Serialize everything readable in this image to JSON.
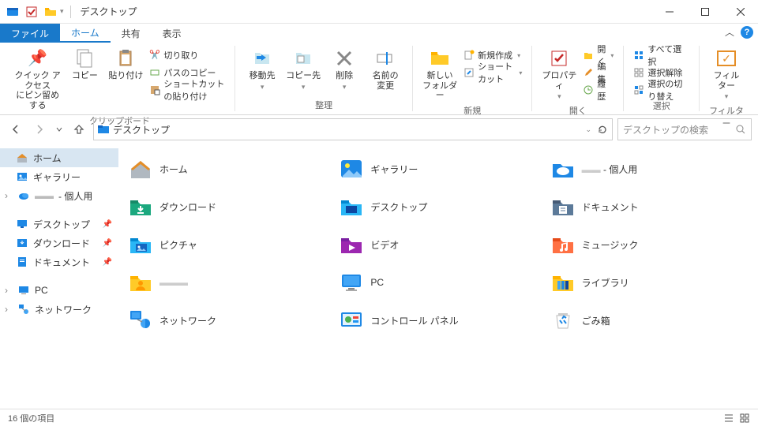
{
  "titlebar": {
    "title": "デスクトップ"
  },
  "tabs": {
    "file": "ファイル",
    "home": "ホーム",
    "share": "共有",
    "view": "表示"
  },
  "ribbon": {
    "pin": "クイック アクセス\nにピン留めする",
    "copy": "コピー",
    "paste": "貼り付け",
    "cut": "切り取り",
    "copypath": "パスのコピー",
    "pasteshortcut": "ショートカットの貼り付け",
    "group_clipboard": "クリップボード",
    "moveto": "移動先",
    "copyto": "コピー先",
    "delete": "削除",
    "rename": "名前の\n変更",
    "group_organize": "整理",
    "newfolder": "新しい\nフォルダー",
    "newitem": "新規作成",
    "shortcut": "ショートカット",
    "group_new": "新規",
    "properties": "プロパティ",
    "open": "開く",
    "edit": "編集",
    "history": "履歴",
    "group_open": "開く",
    "selectall": "すべて選択",
    "selectnone": "選択解除",
    "invert": "選択の切り替え",
    "group_select": "選択",
    "filter": "フィル\nター",
    "group_filter": "フィルター"
  },
  "nav": {
    "crumb": "デスクトップ",
    "search_ph": "デスクトップの検索"
  },
  "sidebar": {
    "home": "ホーム",
    "gallery": "ギャラリー",
    "personal": "- 個人用",
    "desktop": "デスクトップ",
    "downloads": "ダウンロード",
    "documents": "ドキュメント",
    "pc": "PC",
    "network": "ネットワーク"
  },
  "items": {
    "r1c1": "ホーム",
    "r1c2": "ギャラリー",
    "r1c3": "- 個人用",
    "r2c1": "ダウンロード",
    "r2c2": "デスクトップ",
    "r2c3": "ドキュメント",
    "r3c1": "ピクチャ",
    "r3c2": "ビデオ",
    "r3c3": "ミュージック",
    "r4c1": "",
    "r4c2": "PC",
    "r4c3": "ライブラリ",
    "r5c1": "ネットワーク",
    "r5c2": "コントロール パネル",
    "r5c3": "ごみ箱"
  },
  "status": {
    "count": "16 個の項目"
  }
}
